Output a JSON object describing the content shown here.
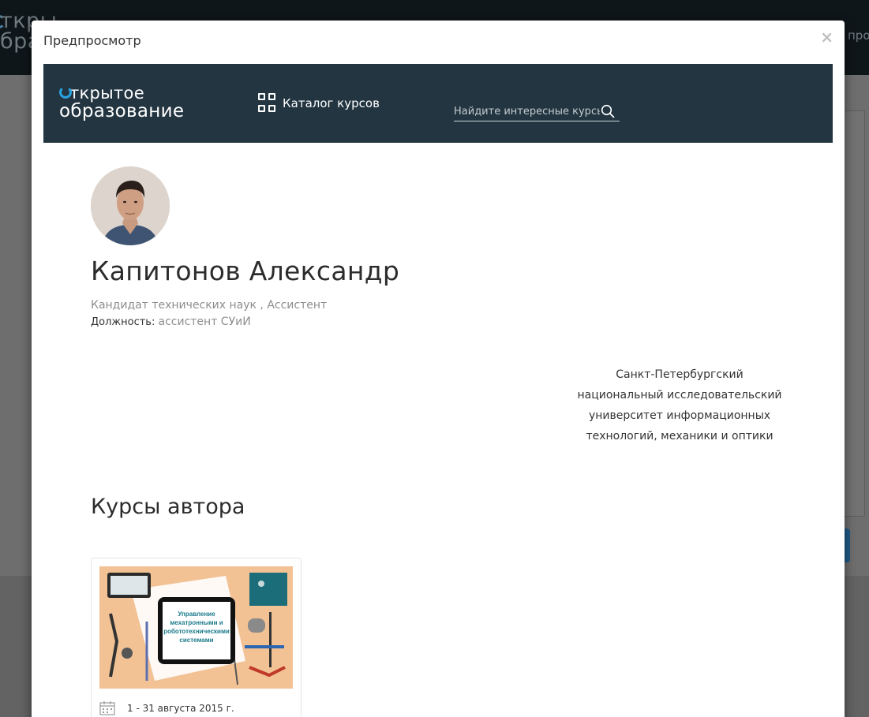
{
  "background": {
    "logo_line1": "ткры",
    "logo_line2": "бра",
    "right_text": "про"
  },
  "modal": {
    "title": "Предпросмотр",
    "close_label": "×"
  },
  "site_header": {
    "logo_line1": "ткрытое",
    "logo_line2": "образование",
    "catalog_label": "Каталог курсов",
    "search_placeholder": "Найдите интересные курсь"
  },
  "profile": {
    "name": "Капитонов Александр",
    "degree": "Кандидат технических наук , Ассистент",
    "position_label": "Должность:",
    "position_value": "ассистент СУиИ",
    "university_lines": [
      "Санкт-Петербургский",
      "национальный исследовательский",
      "университет информационных",
      "технологий, механики и оптики"
    ]
  },
  "courses": {
    "title": "Курсы автора",
    "items": [
      {
        "image_text": [
          "Управление",
          "мехатронными и",
          "робототехническими",
          "системами"
        ],
        "date": "1 - 31 августа 2015 г."
      }
    ]
  },
  "colors": {
    "site_header_bg": "#223541",
    "logo_accent": "#29a3e0",
    "course_image_bg": "#f2c295"
  }
}
